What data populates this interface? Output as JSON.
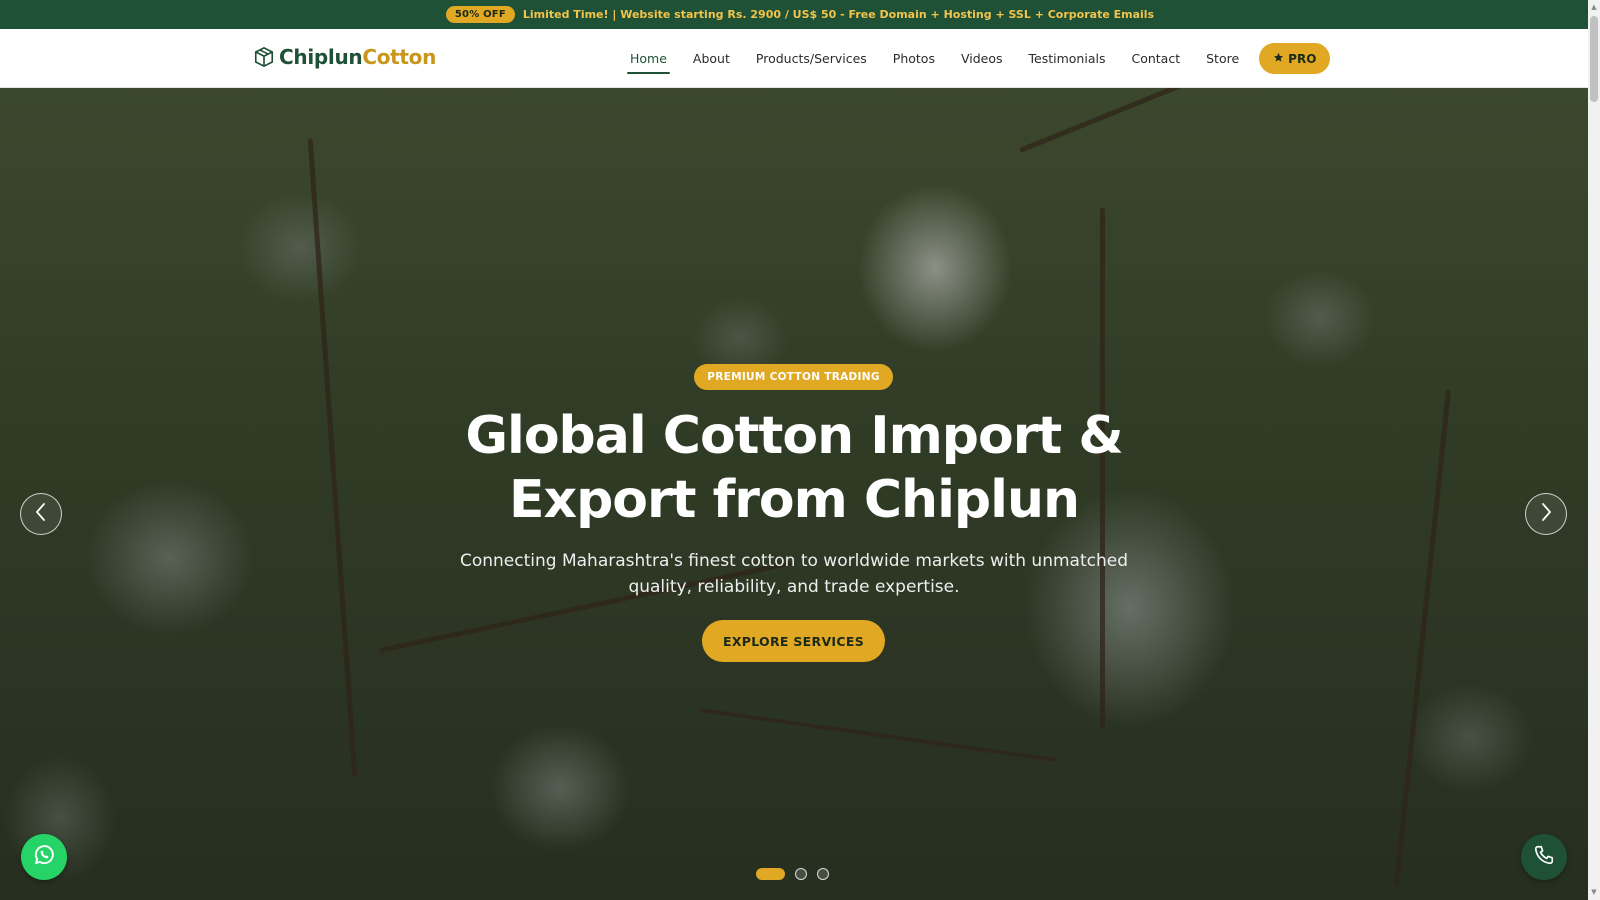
{
  "promo": {
    "badge": "50% OFF",
    "text": "Limited Time! | Website starting Rs. 2900 / US$ 50 - Free Domain + Hosting + SSL + Corporate Emails"
  },
  "brand": {
    "name_part1": "Chiplun",
    "name_part2": "Cotton",
    "icon": "box-icon"
  },
  "nav": {
    "items": [
      {
        "label": "Home",
        "active": true
      },
      {
        "label": "About"
      },
      {
        "label": "Products/Services"
      },
      {
        "label": "Photos"
      },
      {
        "label": "Videos"
      },
      {
        "label": "Testimonials"
      },
      {
        "label": "Contact"
      },
      {
        "label": "Store"
      }
    ],
    "pro_label": "PRO",
    "pro_icon": "star-icon"
  },
  "hero": {
    "tag": "PREMIUM COTTON TRADING",
    "title_line1": "Global Cotton Import &",
    "title_line2": "Export from Chiplun",
    "subtitle_line1": "Connecting Maharashtra's finest cotton to worldwide markets with unmatched",
    "subtitle_line2": "quality, reliability, and trade expertise.",
    "cta_label": "EXPLORE SERVICES",
    "slides_total": 3,
    "active_slide": 1
  },
  "floating": {
    "whatsapp_icon": "whatsapp-icon",
    "phone_icon": "phone-icon"
  },
  "colors": {
    "brand_green": "#1f5136",
    "accent_gold": "#e0a823",
    "whatsapp_green": "#25d366"
  }
}
